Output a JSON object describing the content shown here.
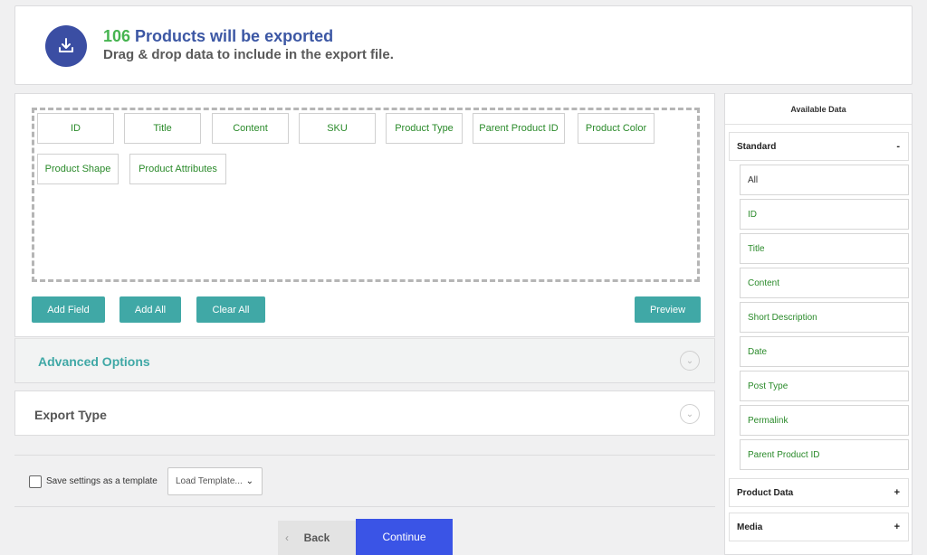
{
  "header": {
    "count": "106",
    "title_rest": " Products will be exported",
    "subtitle": "Drag & drop data to include in the export file."
  },
  "selected_fields": [
    "ID",
    "Title",
    "Content",
    "SKU",
    "Product Type",
    "Parent Product ID",
    "Product Color",
    "Product Shape",
    "Product Attributes"
  ],
  "buttons": {
    "add_field": "Add Field",
    "add_all": "Add All",
    "clear_all": "Clear All",
    "preview": "Preview",
    "back": "Back",
    "continue": "Continue"
  },
  "panels": {
    "advanced": "Advanced Options",
    "export_type": "Export Type"
  },
  "template": {
    "save_label": "Save settings as a template",
    "load_placeholder": "Load Template..."
  },
  "sidebar": {
    "title": "Available Data",
    "standard": {
      "label": "Standard",
      "sign": "-",
      "items": [
        "All",
        "ID",
        "Title",
        "Content",
        "Short Description",
        "Date",
        "Post Type",
        "Permalink",
        "Parent Product ID"
      ]
    },
    "product_data": {
      "label": "Product Data",
      "sign": "+"
    },
    "media": {
      "label": "Media",
      "sign": "+"
    }
  },
  "colors": {
    "accent_teal": "#40a8a6",
    "primary_blue": "#3a54e6",
    "count_green": "#46b450",
    "title_blue": "#3c57a4",
    "field_green": "#2a8a2a"
  },
  "icons": {
    "export": "download-tray-icon",
    "chevron": "chevron-down-icon",
    "caret": "caret-down-icon",
    "back": "arrow-left-icon"
  }
}
